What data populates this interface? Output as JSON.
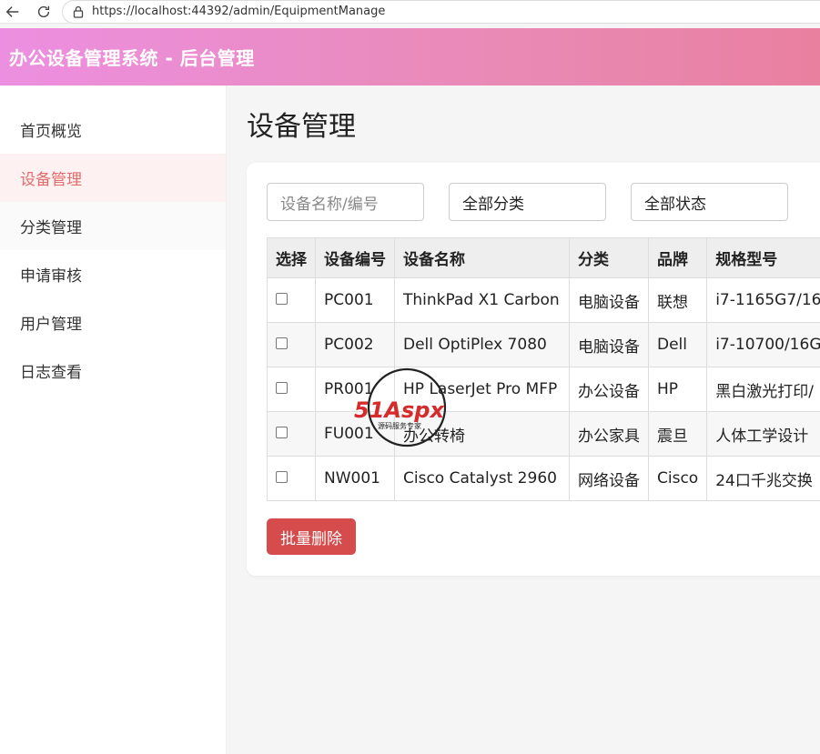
{
  "browser": {
    "url": "https://localhost:44392/admin/EquipmentManage"
  },
  "header": {
    "title": "办公设备管理系统 - 后台管理"
  },
  "sidebar": {
    "items": [
      {
        "label": "首页概览"
      },
      {
        "label": "设备管理"
      },
      {
        "label": "分类管理"
      },
      {
        "label": "申请审核"
      },
      {
        "label": "用户管理"
      },
      {
        "label": "日志查看"
      }
    ]
  },
  "main": {
    "title": "设备管理",
    "filters": {
      "search_placeholder": "设备名称/编号",
      "category": "全部分类",
      "status": "全部状态"
    },
    "table": {
      "headers": [
        "选择",
        "设备编号",
        "设备名称",
        "分类",
        "品牌",
        "规格型号"
      ],
      "rows": [
        {
          "code": "PC001",
          "name": "ThinkPad X1 Carbon",
          "category": "电脑设备",
          "brand": "联想",
          "spec": "i7-1165G7/16"
        },
        {
          "code": "PC002",
          "name": "Dell OptiPlex 7080",
          "category": "电脑设备",
          "brand": "Dell",
          "spec": "i7-10700/16G"
        },
        {
          "code": "PR001",
          "name": "HP LaserJet Pro MFP",
          "category": "办公设备",
          "brand": "HP",
          "spec": "黑白激光打印/"
        },
        {
          "code": "FU001",
          "name": "办公转椅",
          "category": "办公家具",
          "brand": "震旦",
          "spec": "人体工学设计"
        },
        {
          "code": "NW001",
          "name": "Cisco Catalyst 2960",
          "category": "网络设备",
          "brand": "Cisco",
          "spec": "24口千兆交换"
        }
      ]
    },
    "batch_delete_label": "批量删除"
  },
  "watermark": {
    "brand": "51Aspx",
    "tagline": "源码服务专家"
  },
  "colors": {
    "accent": "#e26b6b",
    "danger": "#d64b4b",
    "header_start": "#ec8fe0",
    "header_end": "#e980a0"
  }
}
